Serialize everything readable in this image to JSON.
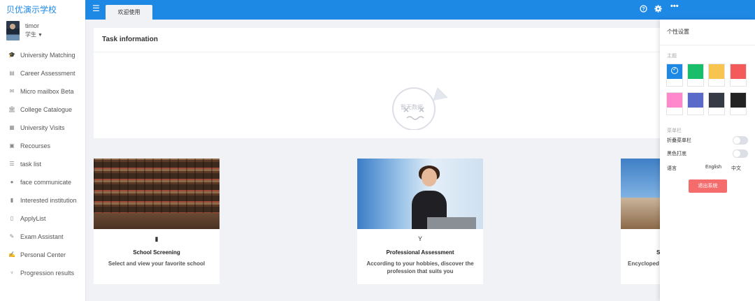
{
  "brand": "贝优演示学校",
  "user": {
    "name": "timor",
    "role": "学生"
  },
  "menu": [
    {
      "label": "University Matching",
      "icon": "graduation-cap-icon",
      "glyph": "🎓"
    },
    {
      "label": "Career Assessment",
      "icon": "clipboard-icon",
      "glyph": "▤"
    },
    {
      "label": "Micro mailbox Beta",
      "icon": "envelope-icon",
      "glyph": "✉"
    },
    {
      "label": "College Catalogue",
      "icon": "institution-icon",
      "glyph": "🏛"
    },
    {
      "label": "University Visits",
      "icon": "calendar-icon",
      "glyph": "▦"
    },
    {
      "label": "Recourses",
      "icon": "briefcase-icon",
      "glyph": "▣"
    },
    {
      "label": "task list",
      "icon": "list-icon",
      "glyph": "☰"
    },
    {
      "label": "face communicate",
      "icon": "user-icon",
      "glyph": "●"
    },
    {
      "label": "Interested institution",
      "icon": "clipboard-check-icon",
      "glyph": "▮"
    },
    {
      "label": "ApplyList",
      "icon": "file-icon",
      "glyph": "▯"
    },
    {
      "label": "Exam Assistant",
      "icon": "edit-icon",
      "glyph": "✎"
    },
    {
      "label": "Personal Center",
      "icon": "pencil-square-icon",
      "glyph": "✍"
    },
    {
      "label": "Progression results",
      "icon": "trophy-icon",
      "glyph": "♆"
    }
  ],
  "topbar": {
    "tab_label": "欢迎使用",
    "menu_icon": "hamburger-menu-icon",
    "help_icon": "question-circle-icon",
    "settings_icon": "gear-icon",
    "more_icon": "ellipsis-icon"
  },
  "task": {
    "title": "Task information",
    "empty_text": "暂无数据"
  },
  "features": [
    {
      "icon": "bookmark-icon",
      "glyph": "▮",
      "title": "School Screening",
      "desc": "Select and view your favorite school"
    },
    {
      "icon": "fork-icon",
      "glyph": "Y",
      "title": "Professional Assessment",
      "desc": "According to your hobbies, discover the profession that suits you"
    },
    {
      "icon": "",
      "glyph": "",
      "title": "S",
      "desc": "Encycloped"
    }
  ],
  "settings": {
    "title": "个性设置",
    "theme_label": "主题",
    "themes": [
      "#1e88e5",
      "#19be6b",
      "#f7c54f",
      "#f55a5a",
      "#ff88cc",
      "#5a6ac8",
      "#353a45",
      "#222222"
    ],
    "selected_theme": 0,
    "sidebar_label": "菜单栏",
    "collapse_label": "折叠菜单栏",
    "dark_label": "黑色打底",
    "collapse_on": false,
    "dark_on": false,
    "language_label": "语言",
    "lang_en": "English",
    "lang_zh": "中文",
    "logout_label": "退出系统"
  },
  "colors": {
    "primary": "#1e88e5",
    "danger": "#f56c6c"
  }
}
